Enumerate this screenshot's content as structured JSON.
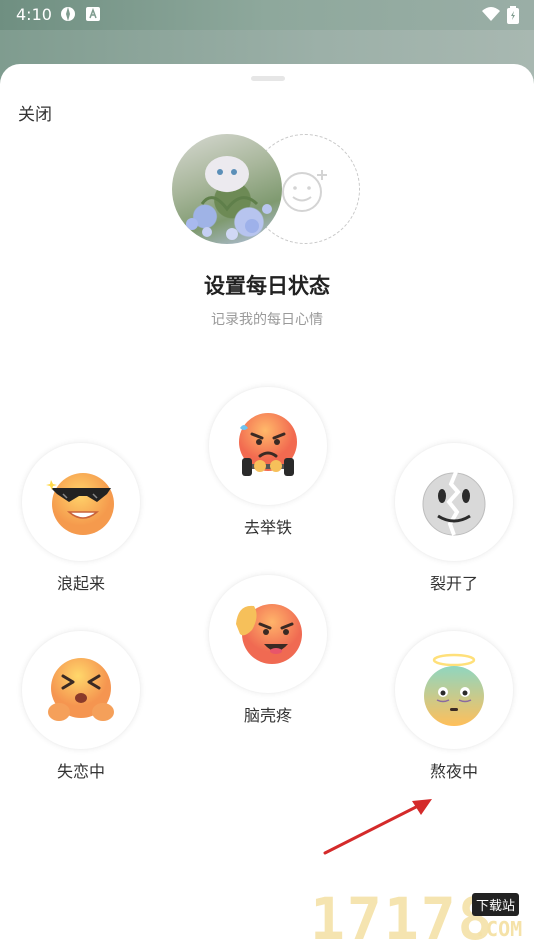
{
  "status_bar": {
    "time": "4:10"
  },
  "header": {
    "close_label": "关闭"
  },
  "profile": {
    "title": "设置每日状态",
    "subtitle": "记录我的每日心情"
  },
  "moods": [
    {
      "label": "浪起来",
      "icon": "cool-sunglasses-emoji-icon"
    },
    {
      "label": "去举铁",
      "icon": "angry-lifting-dumbbell-emoji-icon"
    },
    {
      "label": "裂开了",
      "icon": "cracked-face-emoji-icon"
    },
    {
      "label": "失恋中",
      "icon": "squinting-crying-emoji-icon"
    },
    {
      "label": "脑壳疼",
      "icon": "headache-emoji-icon"
    },
    {
      "label": "熬夜中",
      "icon": "halo-sleepy-emoji-icon"
    }
  ],
  "watermark": {
    "number": "17178",
    "badge": "下载站",
    "suffix": ".COM"
  },
  "colors": {
    "accent_arrow": "#d42a2a",
    "sheet_bg": "#ffffff"
  }
}
